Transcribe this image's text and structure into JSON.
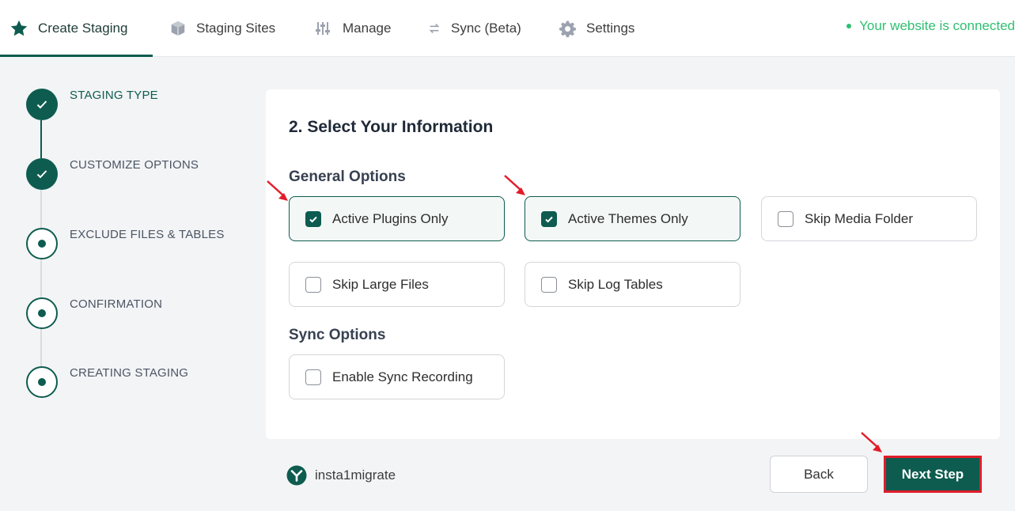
{
  "nav": {
    "tabs": [
      {
        "label": "Create Staging",
        "icon": "star-icon",
        "active": true
      },
      {
        "label": "Staging Sites",
        "icon": "cube-icon",
        "active": false
      },
      {
        "label": "Manage",
        "icon": "sliders-icon",
        "active": false
      },
      {
        "label": "Sync (Beta)",
        "icon": "sync-icon",
        "active": false
      },
      {
        "label": "Settings",
        "icon": "gear-icon",
        "active": false
      }
    ],
    "status": "Your website is connected"
  },
  "steps": [
    {
      "label": "STAGING TYPE",
      "state": "done"
    },
    {
      "label": "CUSTOMIZE OPTIONS",
      "state": "done"
    },
    {
      "label": "EXCLUDE FILES & TABLES",
      "state": "pending"
    },
    {
      "label": "CONFIRMATION",
      "state": "pending"
    },
    {
      "label": "CREATING STAGING",
      "state": "pending"
    }
  ],
  "card": {
    "title": "2. Select Your Information",
    "general_title": "General Options",
    "general_options": [
      {
        "label": "Active Plugins Only",
        "checked": true
      },
      {
        "label": "Active Themes Only",
        "checked": true
      },
      {
        "label": "Skip Media Folder",
        "checked": false
      },
      {
        "label": "Skip Large Files",
        "checked": false
      },
      {
        "label": "Skip Log Tables",
        "checked": false
      }
    ],
    "sync_title": "Sync Options",
    "sync_options": [
      {
        "label": "Enable Sync Recording",
        "checked": false
      }
    ]
  },
  "footer": {
    "brand": "insta1migrate",
    "back_label": "Back",
    "next_label": "Next Step"
  },
  "colors": {
    "primary": "#0d5c4f",
    "connected": "#2fbf71",
    "highlight": "#e11d2a"
  }
}
